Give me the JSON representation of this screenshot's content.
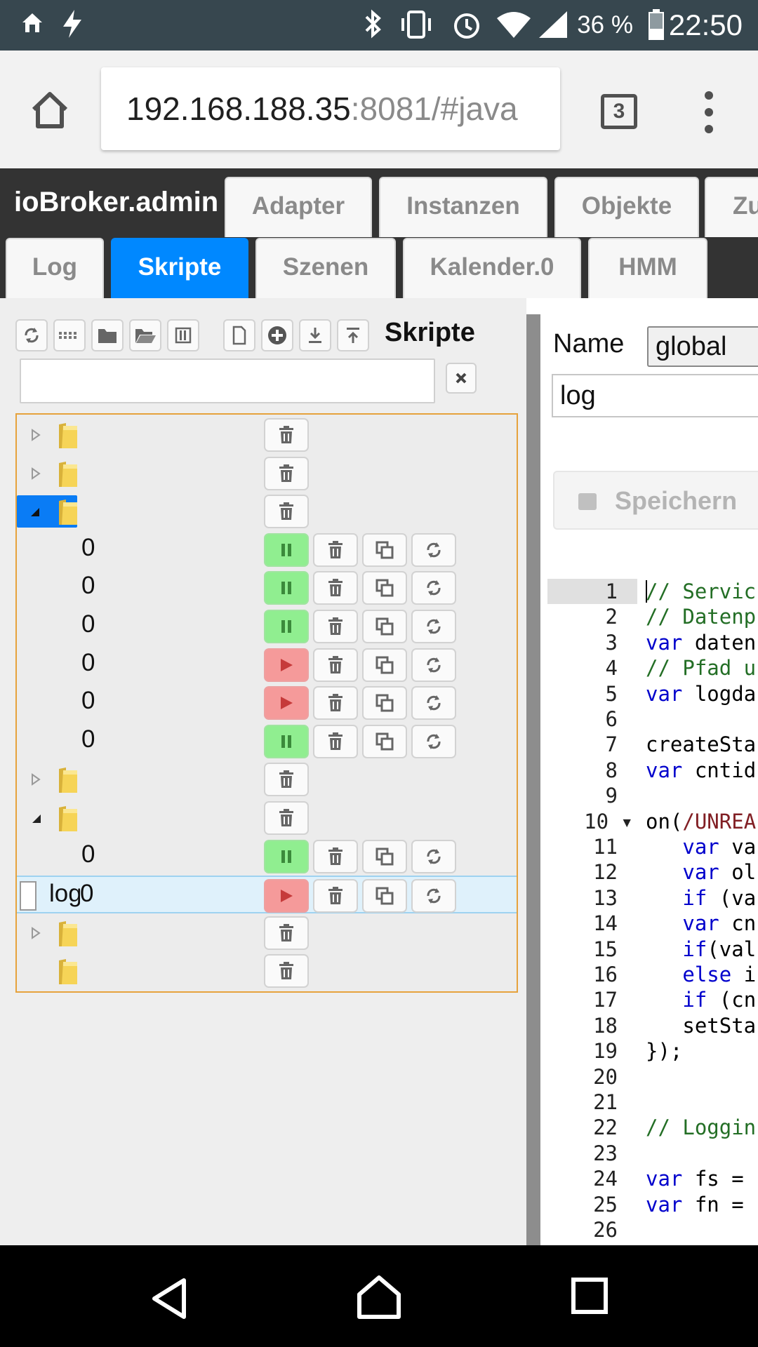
{
  "status_bar": {
    "battery_percent": "36 %",
    "time": "22:50"
  },
  "browser": {
    "url_host": "192.168.188.35",
    "url_rest": ":8081/#java",
    "tab_count": "3"
  },
  "app": {
    "brand": "ioBroker.admin",
    "top_tabs": [
      "Adapter",
      "Instanzen",
      "Objekte",
      "Zu"
    ],
    "second_tabs": [
      "Log",
      "Skripte",
      "Szenen",
      "Kalender.0",
      "HMM"
    ],
    "active_tab": "Skripte"
  },
  "script_panel": {
    "title": "Skripte",
    "filter_value": "",
    "tree_rows": [
      {
        "type": "folder",
        "expanded": false,
        "label": ""
      },
      {
        "type": "folder",
        "expanded": false,
        "label": ""
      },
      {
        "type": "folder",
        "expanded": true,
        "label": "",
        "selected": true
      },
      {
        "type": "script",
        "label": "0",
        "state": "running"
      },
      {
        "type": "script",
        "label": "0",
        "state": "running"
      },
      {
        "type": "script",
        "label": "0",
        "state": "running"
      },
      {
        "type": "script",
        "label": "0",
        "state": "stopped"
      },
      {
        "type": "script",
        "label": "0",
        "state": "stopped"
      },
      {
        "type": "script",
        "label": "0",
        "state": "running"
      },
      {
        "type": "folder",
        "expanded": false,
        "label": ""
      },
      {
        "type": "folder",
        "expanded": true,
        "label": ""
      },
      {
        "type": "script",
        "label": "0",
        "state": "running"
      },
      {
        "type": "script-file",
        "label": "log",
        "label2": "0",
        "state": "stopped",
        "highlighted": true
      },
      {
        "type": "folder",
        "expanded": false,
        "label": ""
      },
      {
        "type": "folder",
        "expanded": null,
        "label": ""
      }
    ]
  },
  "editor_panel": {
    "name_label": "Name",
    "engine_value": "global",
    "name_value": "log",
    "save_label": "Speichern",
    "code_lines": [
      "// Servic",
      "// Datenp",
      "var daten",
      "// Pfad u",
      "var logda",
      "",
      "createSta",
      "var cntid",
      "",
      "on(/UNREA",
      "   var va",
      "   var ol",
      "   if (va",
      "   var cn",
      "   if(val",
      "   else i",
      "   if (cn",
      "   setSta",
      "});",
      "",
      "",
      "// Loggin",
      "",
      "var fs = ",
      "var fn = ",
      ""
    ]
  },
  "colors": {
    "accent": "#0088ff",
    "header_bg": "#333333",
    "status_bar_bg": "#37474f",
    "running_green": "#90ee90",
    "stopped_red": "#f59a9a",
    "tree_border": "#e6a23c"
  }
}
